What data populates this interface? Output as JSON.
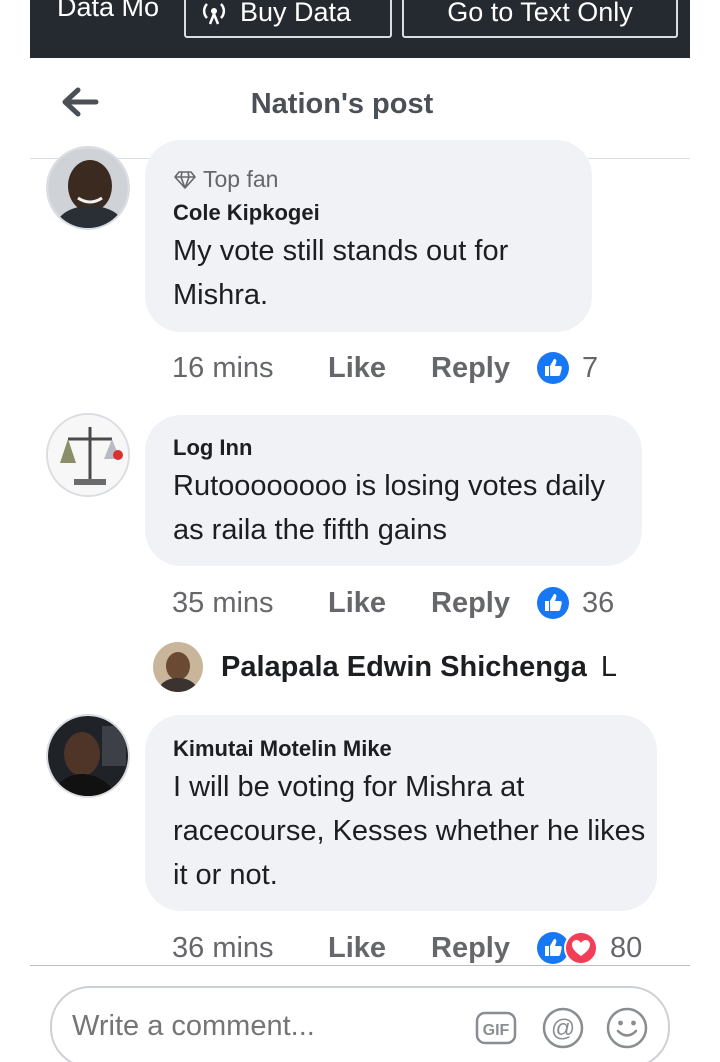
{
  "databar": {
    "mode_label": "Data Mo",
    "buy_label": "Buy Data",
    "text_only_label": "Go to Text Only"
  },
  "header": {
    "title": "Nation's post"
  },
  "comments": [
    {
      "badge": "Top fan",
      "author": "Cole Kipkogei",
      "text": "My vote still stands out for Mishra.",
      "time": "16 mins",
      "like": "Like",
      "reply": "Reply",
      "reactions": [
        "like"
      ],
      "count": "7"
    },
    {
      "author": "Log Inn",
      "text": "Rutoooooooo is losing votes daily as raila the fifth gains",
      "time": "35 mins",
      "like": "Like",
      "reply": "Reply",
      "reactions": [
        "like"
      ],
      "count": "36"
    },
    {
      "author": "Kimutai Motelin Mike",
      "text": "I will be voting for Mishra at racecourse, Kesses whether he likes it or not.",
      "time": "36 mins",
      "like": "Like",
      "reply": "Reply",
      "reactions": [
        "like",
        "love"
      ],
      "count": "80"
    }
  ],
  "reply_preview": {
    "author": "Palapala Edwin Shichenga",
    "text": "L"
  },
  "composer": {
    "placeholder": "Write a comment...",
    "icons": [
      "gif-icon",
      "mention-icon",
      "emoji-icon"
    ]
  },
  "colors": {
    "like_blue": "#1877f2",
    "love_red": "#f33e58",
    "bubble": "#f0f2f5",
    "databar": "#252a31"
  }
}
